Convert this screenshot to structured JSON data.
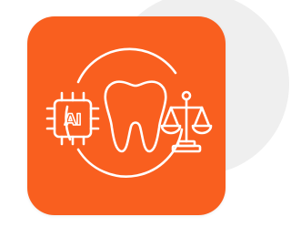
{
  "icon": {
    "background_color": "#f95f1f",
    "line_color": "#ffffff",
    "backdrop_color": "#efefef",
    "chip_label": "AI",
    "symbols": [
      "circle-ring-icon",
      "ai-chip-icon",
      "tooth-icon",
      "balance-scale-icon"
    ]
  }
}
